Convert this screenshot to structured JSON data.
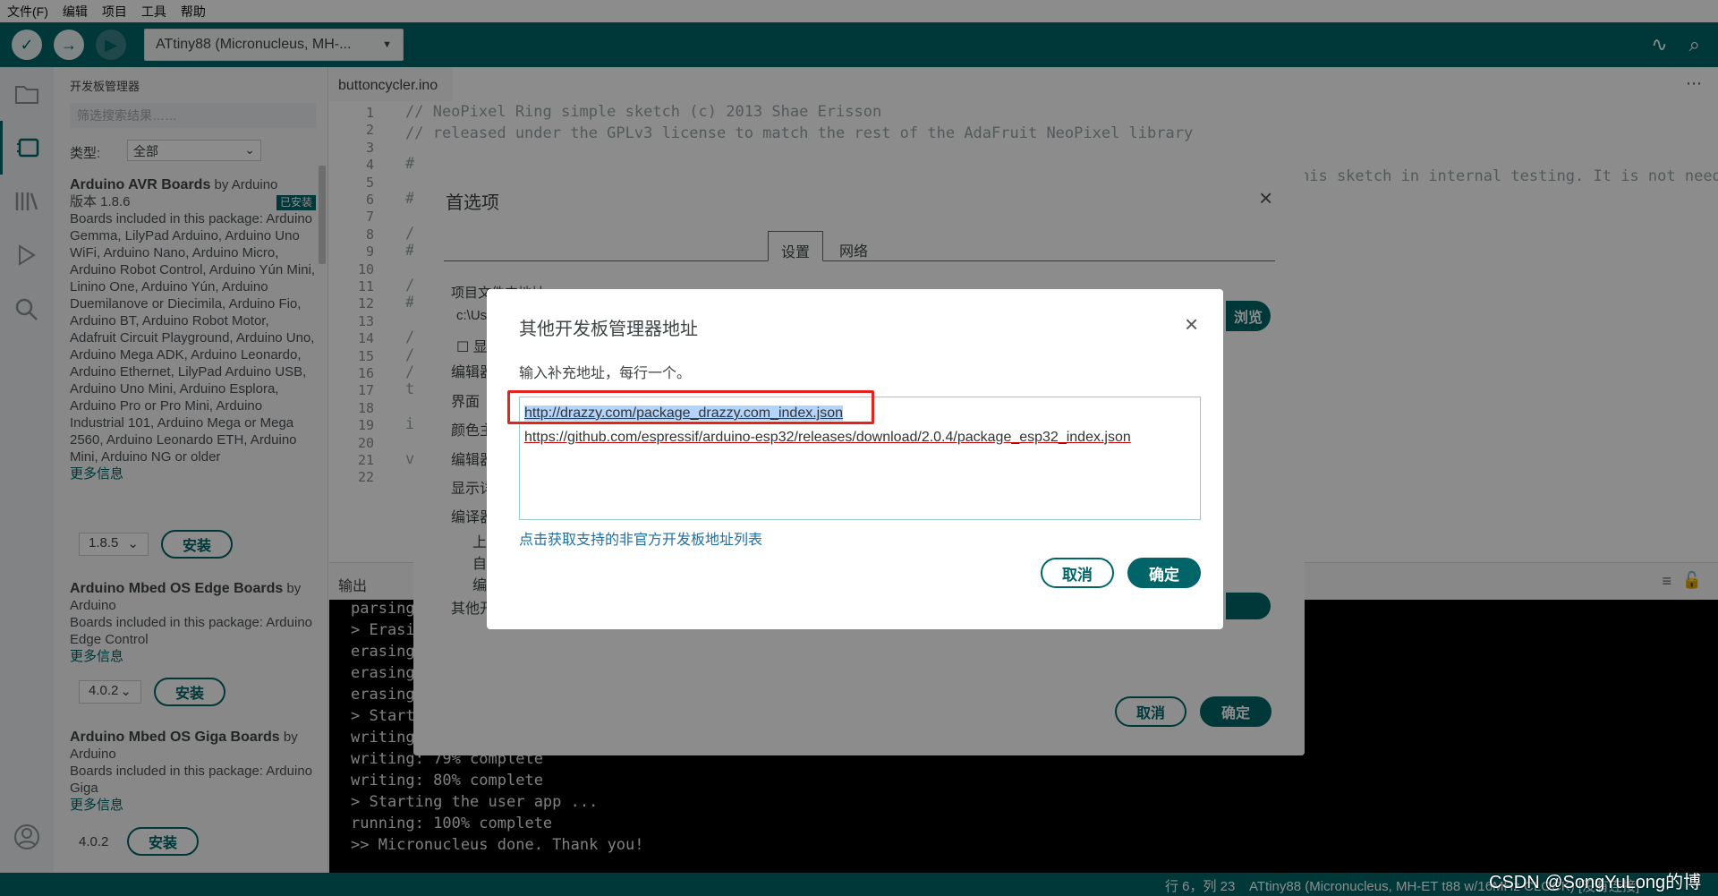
{
  "menu": [
    "文件(F)",
    "编辑",
    "项目",
    "工具",
    "帮助"
  ],
  "toolbar": {
    "verify_icon": "checkmark-icon",
    "upload_icon": "arrow-right-icon",
    "debug_icon": "debug-icon",
    "board": "ATtiny88 (Micronucleus, MH-...",
    "colors": {
      "primary": "#006468",
      "secondary": "#eaf3f3"
    }
  },
  "boards_manager": {
    "title": "开发板管理器",
    "search_placeholder": "筛选搜索结果……",
    "type_label": "类型:",
    "type_value": "全部",
    "cards": [
      {
        "name": "Arduino AVR Boards",
        "by": " by Arduino",
        "version": "版本 1.8.6",
        "badge": "已安装",
        "desc": "Boards included in this package: Arduino Gemma, LilyPad Arduino, Arduino Uno WiFi, Arduino Nano, Arduino Micro, Arduino Robot Control, Arduino Yún Mini, Linino One, Arduino Yún, Arduino Duemilanove or Diecimila, Arduino Fio, Arduino BT, Arduino Robot Motor, Adafruit Circuit Playground, Arduino Uno, Arduino Mega ADK, Arduino Leonardo, Arduino Ethernet, LilyPad Arduino USB, Arduino Uno Mini, Arduino Esplora, Arduino Pro or Pro Mini, Arduino Industrial 101, Arduino Mega or Mega 2560, Arduino Leonardo ETH, Arduino Mini, Arduino NG or older",
        "more": "更多信息",
        "select_version": "1.8.5",
        "action": "安装"
      },
      {
        "name": "Arduino Mbed OS Edge Boards",
        "by": " by Arduino",
        "desc": "Boards included in this package: Arduino Edge Control",
        "more": "更多信息",
        "select_version": "4.0.2",
        "action": "安装"
      },
      {
        "name": "Arduino Mbed OS Giga Boards",
        "by": " by Arduino",
        "desc": "Boards included in this package: Arduino Giga",
        "more": "更多信息",
        "select_version": "4.0.2",
        "action": "安装"
      }
    ]
  },
  "editor": {
    "tab": "buttoncycler.ino",
    "line_numbers": [
      "1",
      "2",
      "3",
      "4",
      "5",
      "6",
      "7",
      "8",
      "9",
      "10",
      "11",
      "12",
      "13",
      "14",
      "15",
      "16",
      "17",
      "18",
      "19",
      "20",
      "21",
      "22"
    ],
    "code": [
      "// NeoPixel Ring simple sketch (c) 2013 Shae Erisson",
      "// released under the GPLv3 license to match the rest of the AdaFruit NeoPixel library"
    ],
    "code_fragment_right": "his sketch in internal testing. It is not needed",
    "code_fragments_left": [
      "#",
      "#",
      "/",
      "#",
      "/",
      "#",
      "/",
      "/",
      "/",
      "t",
      "i",
      "v"
    ]
  },
  "output": {
    "title": "输出",
    "lines": [
      "parsing",
      "> Erasi",
      "erasing",
      "erasing",
      "erasing",
      "> Start",
      "writing",
      "writing: 79% complete",
      "writing: 80% complete",
      "> Starting the user app ...",
      "running: 100% complete",
      ">> Micronucleus done. Thank you!"
    ]
  },
  "status": {
    "position": "行 6，列 23",
    "board": "ATtiny88 (Micronucleus, MH-ET t88 w/16MHz CLOCK) [没有连接]",
    "watermark": "CSDN @SongYuLong的博客"
  },
  "preferences": {
    "title": "首选项",
    "tabs": [
      "设置",
      "网络"
    ],
    "active_tab": "设置",
    "fragments": [
      "项目文件夹地址",
      "c:\\Us",
      "显",
      "编辑器",
      "界面",
      "颜色主",
      "编辑器",
      "显示详",
      "编译器",
      "上",
      "自",
      "编",
      "其他开"
    ],
    "browse": "浏览",
    "cancel": "取消",
    "ok": "确定"
  },
  "additional_urls": {
    "title": "其他开发板管理器地址",
    "description": "输入补充地址，每行一个。",
    "urls": [
      "http://drazzy.com/package_drazzy.com_index.json",
      "https://github.com/espressif/arduino-esp32/releases/download/2.0.4/package_esp32_index.json"
    ],
    "link": "点击获取支持的非官方开发板地址列表",
    "cancel": "取消",
    "ok": "确定",
    "highlight_color": "#e4231e"
  }
}
